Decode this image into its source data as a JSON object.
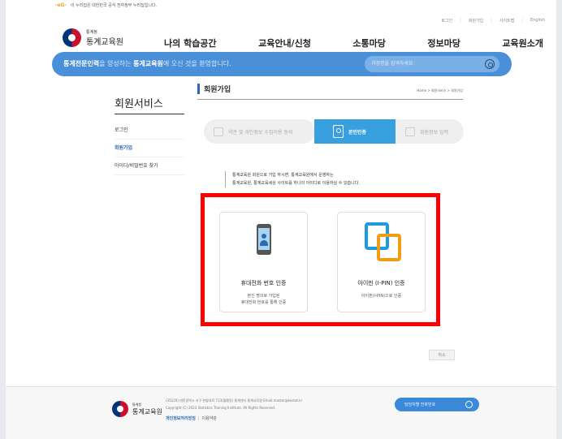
{
  "gov_strip": {
    "mark": "-eG-",
    "text": "이 누리집은 대한민국 공식 전자정부 누리집입니다."
  },
  "util": {
    "login": "로그인",
    "join": "회원가입",
    "sitemap": "사이트맵",
    "english": "English"
  },
  "logo": {
    "small": "통계청",
    "name": "통계교육원"
  },
  "gnb": [
    "나의 학습공간",
    "교육안내/신청",
    "소통마당",
    "정보마당",
    "교육원소개"
  ],
  "banner": {
    "highlight1": "통계전문인력",
    "mid": "을 양성하는 ",
    "highlight2": "통계교육원",
    "tail": "에 오신 것을 환영합니다.",
    "search_placeholder": "과정명을 검색하세요."
  },
  "side": {
    "title": "회원서비스",
    "items": [
      "로그인",
      "회원가입",
      "아이디/비밀번호 찾기"
    ]
  },
  "content": {
    "title": "회원가입",
    "breadcrumb": "Home > 회원서비스 > 회원가입"
  },
  "steps": [
    "약관 및 개인정보 수집이용 동의",
    "본인인증",
    "회원정보 입력"
  ],
  "notice": {
    "line1": "통계교육원 회원으로 가입 하시면, 통계교육원에서 운영하는",
    "line2": "통계교육원, 통계교육세상 사이트를 하나의 아이디로 이용하실 수 있습니다."
  },
  "cards": [
    {
      "title": "휴대전화 번호 인증",
      "desc1": "본인 명의로 가입된",
      "desc2": "휴대전화 번호를 통해 인증"
    },
    {
      "title": "아이핀 (I-PIN) 인증",
      "desc1": "아이핀(I-PIN)으로 인증"
    }
  ],
  "cancel": "취소",
  "footer": {
    "logo_small": "통계청",
    "logo_name": "통계교육원",
    "address": "(35220) 대전광역시 서구 한밭대로 713(월평동) 통계센터 통계교육원 Email:master@kostat.kr",
    "copyright": "Copyright (C) 2023 Statistics Training Institute. All Rights Reserved.",
    "privacy": "개인정보처리방침",
    "terms": "이용약관",
    "search_placeholder": "담당자별 전화번호"
  },
  "colors": {
    "accent": "#4a90d9",
    "step_active": "#39a0e0",
    "highlight": "#ff0000",
    "ipin_blue": "#1e9be0",
    "ipin_orange": "#f39c12"
  }
}
